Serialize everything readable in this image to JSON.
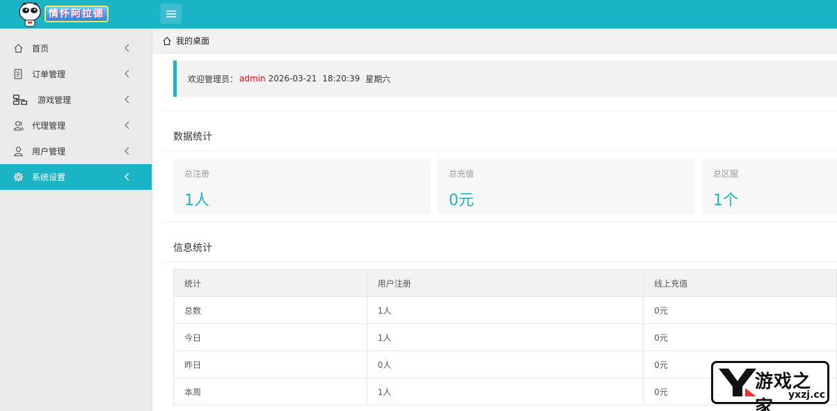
{
  "header": {
    "logo_text": "情怀阿拉德",
    "accent_color": "#1bb3c6"
  },
  "sidebar": {
    "items": [
      {
        "label": "首页",
        "icon": "home-icon"
      },
      {
        "label": "订单管理",
        "icon": "document-icon"
      },
      {
        "label": "游戏管理",
        "icon": "sitemap-icon"
      },
      {
        "label": "代理管理",
        "icon": "users-icon"
      },
      {
        "label": "用户管理",
        "icon": "user-icon"
      },
      {
        "label": "系统设置",
        "icon": "gear-icon",
        "active": true
      }
    ]
  },
  "breadcrumb": {
    "label": "我的桌面"
  },
  "welcome": {
    "prefix": "欢迎管理员：",
    "admin": "admin",
    "date": "2026-03-21",
    "time": "18:20:39",
    "weekday": "星期六"
  },
  "stats": {
    "title": "数据统计",
    "cards": [
      {
        "label": "总注册",
        "value": "1人"
      },
      {
        "label": "总充值",
        "value": "0元"
      },
      {
        "label": "总区服",
        "value": "1个"
      }
    ]
  },
  "info": {
    "title": "信息统计",
    "headers": [
      "统计",
      "用户注册",
      "线上充值"
    ],
    "rows": [
      [
        "总数",
        "1人",
        "0元"
      ],
      [
        "今日",
        "1人",
        "0元"
      ],
      [
        "昨日",
        "0人",
        "0元"
      ],
      [
        "本周",
        "1人",
        "0元"
      ]
    ]
  },
  "watermark": {
    "name": "游戏之家",
    "url": "yxzj.cc"
  }
}
